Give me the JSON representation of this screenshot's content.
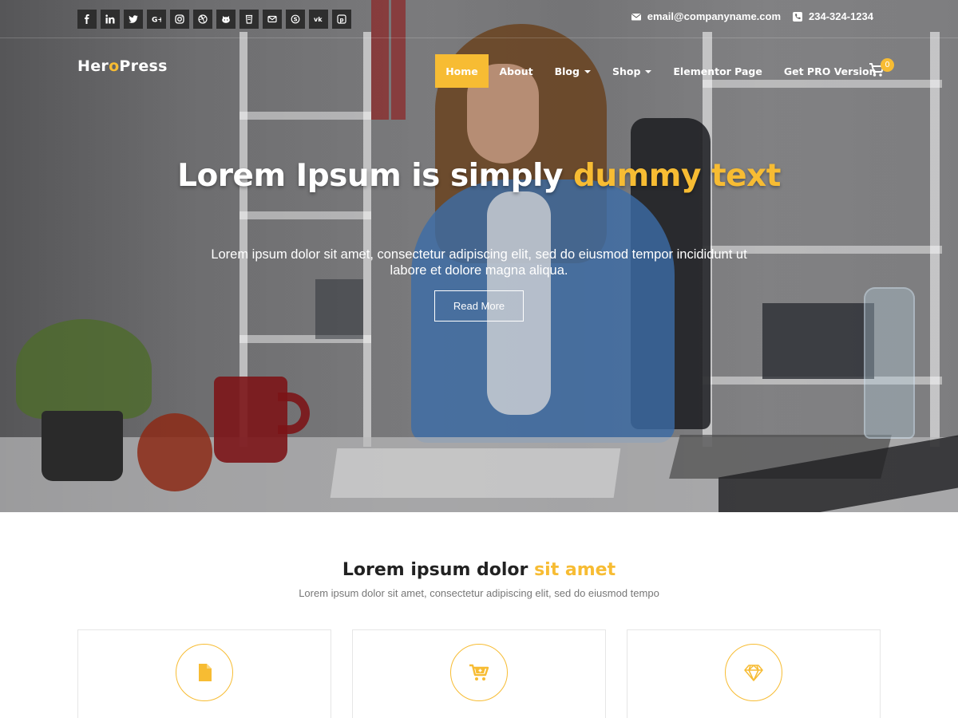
{
  "brand": {
    "logo_part1": "Her",
    "logo_o": "o",
    "logo_part2": "Press",
    "accent_color": "#f7bc33"
  },
  "topbar": {
    "social_icons": [
      "facebook-icon",
      "linkedin-icon",
      "twitter-icon",
      "google-plus-icon",
      "instagram-icon",
      "dribbble-icon",
      "github-icon",
      "fivehundredpx-icon",
      "email-icon",
      "skype-icon",
      "vk-icon",
      "pinterest-icon"
    ],
    "email": "email@companyname.com",
    "phone": "234-324-1234"
  },
  "nav": {
    "items": [
      {
        "label": "Home",
        "active": true
      },
      {
        "label": "About"
      },
      {
        "label": "Blog",
        "dropdown": true
      },
      {
        "label": "Shop",
        "dropdown": true
      },
      {
        "label": "Elementor Page"
      },
      {
        "label": "Get PRO Version"
      }
    ],
    "cart_count": "0"
  },
  "hero": {
    "title_white": "Lorem Ipsum is simply ",
    "title_accent": "dummy text",
    "subtitle": "Lorem ipsum dolor sit amet, consectetur adipiscing elit, sed do eiusmod tempor incididunt ut labore et dolore magna aliqua.",
    "button_label": "Read More"
  },
  "section": {
    "title_dark": "Lorem ipsum dolor ",
    "title_accent": "sit amet",
    "subtitle": "Lorem ipsum dolor sit amet, consectetur adipiscing elit, sed do eiusmod tempo"
  },
  "cards": [
    {
      "icon": "file-icon"
    },
    {
      "icon": "cart-plus-icon"
    },
    {
      "icon": "diamond-icon"
    }
  ]
}
